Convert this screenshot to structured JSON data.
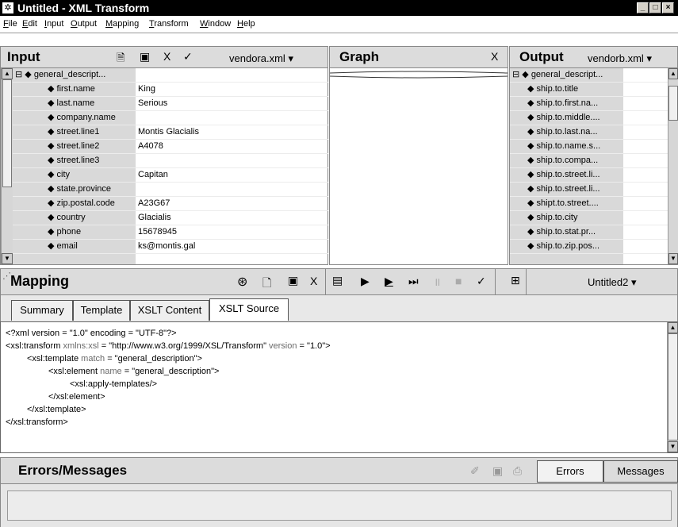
{
  "window": {
    "title": "Untitled - XML Transform",
    "controls": [
      "_",
      "□",
      "×"
    ]
  },
  "menu": [
    "File",
    "Edit",
    "Input",
    "Output",
    "Mapping",
    "Transform",
    "Window",
    "Help"
  ],
  "input_panel": {
    "title": "Input",
    "file": "vendora.xml",
    "root": "general_descript...",
    "rows": [
      {
        "name": "first.name",
        "value": "King"
      },
      {
        "name": "last.name",
        "value": "Serious"
      },
      {
        "name": "company.name",
        "value": ""
      },
      {
        "name": "street.line1",
        "value": "Montis Glacialis"
      },
      {
        "name": "street.line2",
        "value": "A4078"
      },
      {
        "name": "street.line3",
        "value": ""
      },
      {
        "name": "city",
        "value": "Capitan"
      },
      {
        "name": "state.province",
        "value": ""
      },
      {
        "name": "zip.postal.code",
        "value": "A23G67"
      },
      {
        "name": "country",
        "value": "Glacialis"
      },
      {
        "name": "phone",
        "value": "15678945"
      },
      {
        "name": "email",
        "value": "ks@montis.gal"
      }
    ]
  },
  "graph_panel": {
    "title": "Graph",
    "close": "X"
  },
  "output_panel": {
    "title": "Output",
    "file": "vendorb.xml",
    "root": "general_descript...",
    "rows": [
      "ship.to.title",
      "ship.to.first.na...",
      "ship.to.middle....",
      "ship.to.last.na...",
      "ship.to.name.s...",
      "ship.to.compa...",
      "ship.to.street.li...",
      "ship.to.street.li...",
      "shipt.to.street....",
      "ship.to.city",
      "ship.to.stat.pr...",
      "ship.to.zip.pos..."
    ]
  },
  "mapping_panel": {
    "title": "Mapping",
    "mapping_name": "Untitled2",
    "tabs": [
      "Summary",
      "Template",
      "XSLT Content",
      "XSLT Source"
    ],
    "active_tab": "XSLT Source",
    "code": [
      {
        "indent": 0,
        "parts": [
          "<?xml version = \"1.0\" encoding = \"UTF-8\"?>"
        ]
      },
      {
        "indent": 0,
        "parts": [
          "<xsl:transform ",
          "xmlns:xsl",
          " = \"http://www.w3.org/1999/XSL/Transform\" ",
          "version",
          " = \"1.0\">"
        ]
      },
      {
        "indent": 1,
        "parts": [
          "<xsl:template ",
          "match",
          " = \"general_description\">"
        ]
      },
      {
        "indent": 2,
        "parts": [
          "<xsl:element ",
          "name",
          " = \"general_description\">"
        ]
      },
      {
        "indent": 3,
        "parts": [
          "<xsl:apply-templates/>"
        ]
      },
      {
        "indent": 2,
        "parts": [
          "</xsl:element>"
        ]
      },
      {
        "indent": 1,
        "parts": [
          "</xsl:template>"
        ]
      },
      {
        "indent": 0,
        "parts": [
          "</xsl:transform>"
        ]
      }
    ]
  },
  "errors_panel": {
    "title": "Errors/Messages",
    "tabs": [
      "Errors",
      "Messages"
    ]
  }
}
